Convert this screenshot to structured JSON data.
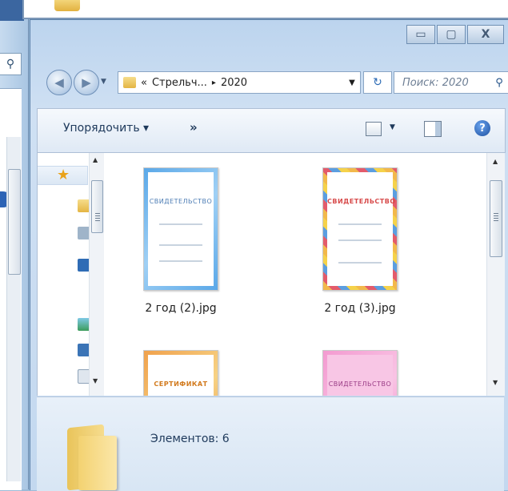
{
  "window": {
    "controls": {
      "minimize": "▭",
      "maximize": "▢",
      "close": "X"
    }
  },
  "background_window": {
    "search_icon": "search-icon",
    "help_icon": "help-icon"
  },
  "navigation": {
    "back_icon": "back-arrow-icon",
    "forward_icon": "forward-arrow-icon",
    "history_dropdown": "▼"
  },
  "address_bar": {
    "prefix": "«",
    "segments": [
      "Стрельч...",
      "2020"
    ],
    "separator": "▸",
    "dropdown": "▼"
  },
  "refresh": {
    "icon": "↻"
  },
  "search": {
    "placeholder": "Поиск: 2020",
    "icon": "⚲"
  },
  "command_bar": {
    "organize_label": "Упорядочить ▾",
    "more_label": "»",
    "views_dropdown": "▼",
    "help_label": "?"
  },
  "files": [
    {
      "name": "2 год (2).jpg",
      "thumb_title": "СВИДЕТЕЛЬСТВО",
      "style": "blue"
    },
    {
      "name": "2 год (3).jpg",
      "thumb_title": "СВИДЕТЕЛЬСТВО",
      "style": "colorful"
    },
    {
      "name": "",
      "thumb_title": "СЕРТИФИКАТ",
      "style": "orange"
    },
    {
      "name": "",
      "thumb_title": "СВИДЕТЕЛЬСТВО",
      "style": "pink"
    }
  ],
  "details": {
    "item_count": "Элементов: 6"
  }
}
